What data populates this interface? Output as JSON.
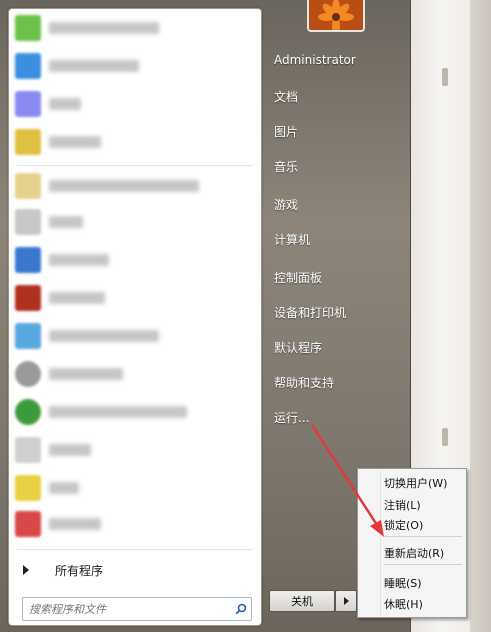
{
  "start_menu": {
    "user_name": "Administrator",
    "right_items": [
      {
        "label": "文档"
      },
      {
        "label": "图片"
      },
      {
        "label": "音乐"
      },
      {
        "label": "游戏"
      },
      {
        "label": "计算机"
      },
      {
        "label": "控制面板"
      },
      {
        "label": "设备和打印机"
      },
      {
        "label": "默认程序"
      },
      {
        "label": "帮助和支持"
      },
      {
        "label": "运行..."
      }
    ],
    "all_programs_label": "所有程序",
    "search": {
      "placeholder": "搜索程序和文件"
    },
    "shutdown_label": "关机",
    "pinned_icons": [
      {
        "color": "#6cc24a",
        "icon": "app-icon"
      },
      {
        "color": "#3c8fe0",
        "icon": "app-icon"
      },
      {
        "color": "#8a8af0",
        "icon": "app-icon"
      },
      {
        "color": "#e0c040",
        "icon": "app-icon"
      }
    ],
    "recent_icons": [
      {
        "color": "#e3d28a",
        "icon": "app-icon"
      },
      {
        "color": "#c8c8c8",
        "icon": "app-icon"
      },
      {
        "color": "#3a78d0",
        "icon": "app-icon"
      },
      {
        "color": "#b03020",
        "icon": "app-icon"
      },
      {
        "color": "#58a8e0",
        "icon": "app-icon"
      },
      {
        "color": "#9a9a9a",
        "icon": "app-icon"
      },
      {
        "color": "#3c9a3c",
        "icon": "app-icon"
      },
      {
        "color": "#d0d0d0",
        "icon": "app-icon"
      },
      {
        "color": "#e8d040",
        "icon": "app-icon"
      },
      {
        "color": "#d84848",
        "icon": "app-icon"
      }
    ]
  },
  "power_menu": {
    "items": [
      {
        "label": "切换用户(W)"
      },
      {
        "label": "注销(L)"
      },
      {
        "label": "锁定(O)"
      },
      {
        "label": "重新启动(R)"
      },
      {
        "label": "睡眠(S)"
      },
      {
        "label": "休眠(H)"
      }
    ]
  },
  "colors": {
    "menu_bg": "#7e776d",
    "pane_bg": "#ffffff",
    "annotation_arrow": "#e23a3a"
  }
}
